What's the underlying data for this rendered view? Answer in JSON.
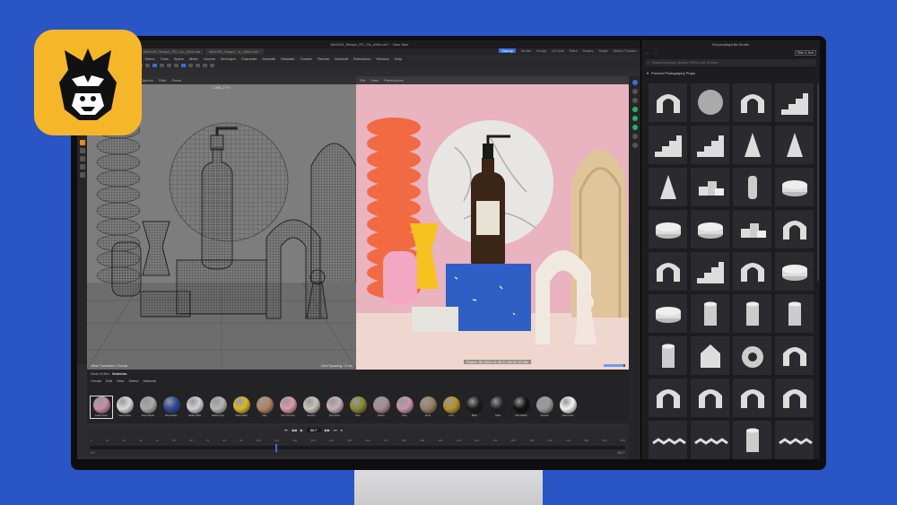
{
  "app": {
    "window_title": "MAXON_Setup1_R3_CA_v004.c4d * - New Take",
    "doc_tabs": [
      "MAXON_Setup1_R3_CA_v004.c4d",
      "MAXON_Setup1_r4_v003.c4d *"
    ],
    "layouts": [
      "Startup",
      "Model",
      "Sculpt",
      "UV Edit",
      "Paint",
      "Nodes",
      "Script",
      "Motion Tracker"
    ],
    "active_layout": "Startup",
    "menus": [
      "File",
      "Edit",
      "Create",
      "Modes",
      "Select",
      "Tools",
      "Spline",
      "Mesh",
      "Volume",
      "MoGraph",
      "Character",
      "Animate",
      "Simulate",
      "Tracker",
      "Render",
      "Redshift",
      "Extensions",
      "Window",
      "Help"
    ]
  },
  "viewport_left": {
    "menus": [
      "View",
      "Cameras",
      "Display",
      "Options",
      "Filter",
      "Panel"
    ],
    "label": "CAM_2 TX",
    "footer_left": "View Transform: Scene",
    "footer_right": "Grid Spacing : 5 cm"
  },
  "viewport_right": {
    "menus": [
      "File",
      "View",
      "Preferences"
    ],
    "render_status": "Frame: 86 2024-11-08 11:58:26 20.00s",
    "progress_label": "Progressive rendering",
    "progress": 0.9
  },
  "materials": {
    "tabs": [
      "Node Editor",
      "Materials"
    ],
    "active_tab": "Materials",
    "menus": [
      "Create",
      "Edit",
      "View",
      "Select",
      "Material"
    ],
    "items": [
      {
        "name": "Scatter Mesh",
        "color": "#c68ea8"
      },
      {
        "name": "Clean White",
        "color": "#d9d9d9"
      },
      {
        "name": "Stone Plastic",
        "color": "#a9a9a9"
      },
      {
        "name": "Blue Plastic",
        "color": "#2d4a9a"
      },
      {
        "name": "Marble White",
        "color": "#d0d0d0"
      },
      {
        "name": "Marble Gray",
        "color": "#b5b5b5"
      },
      {
        "name": "Yellow Paint",
        "color": "#d8b82a"
      },
      {
        "name": "Clay",
        "color": "#b48264"
      },
      {
        "name": "Pink Terrazzo",
        "color": "#d89aa8"
      },
      {
        "name": "Terrazzo",
        "color": "#c9c2b8"
      },
      {
        "name": "Pink Stone",
        "color": "#c8b0b6"
      },
      {
        "name": "Olive",
        "color": "#8a8a32"
      },
      {
        "name": "Mauve",
        "color": "#a88c92"
      },
      {
        "name": "Rose",
        "color": "#c796ac"
      },
      {
        "name": "Wood",
        "color": "#9a7e62"
      },
      {
        "name": "Gold",
        "color": "#b8902c"
      },
      {
        "name": "Black",
        "color": "#1a1a1a"
      },
      {
        "name": "Glass",
        "color": "#222222"
      },
      {
        "name": "Dark Plastic",
        "color": "#111111"
      },
      {
        "name": "Ceramic",
        "color": "#9a9a9a"
      },
      {
        "name": "Glass Clear",
        "color": "#f2f2f2"
      }
    ]
  },
  "timeline": {
    "current_frame": "86 F",
    "start": "0 F",
    "end": "300 F",
    "ruler": [
      "0",
      "10",
      "20",
      "30",
      "40",
      "50",
      "60",
      "70",
      "80",
      "90",
      "100",
      "110",
      "120",
      "130",
      "140",
      "150",
      "160",
      "170",
      "180",
      "190",
      "200",
      "210",
      "220",
      "230",
      "240",
      "250",
      "260",
      "270",
      "280",
      "290",
      "300"
    ]
  },
  "asset_browser": {
    "title": "Greyscalegorilla Studio",
    "filter_label": "Filter & Sort",
    "search_placeholder": "Search Materials, Models, HDRIs, and Textures",
    "section": "Product Photography Props",
    "icons": [
      "arch-prop-icon",
      "disc-prop-icon",
      "arch-tall-prop-icon",
      "stairs-prop-icon",
      "stairs-small-prop-icon",
      "stairs-prop-icon",
      "cone-thin-prop-icon",
      "cone-prop-icon",
      "spike-prop-icon",
      "blocks-prop-icon",
      "pillar-prop-icon",
      "cylinder-step-prop-icon",
      "round-step-prop-icon",
      "round-step-prop-icon",
      "cylinder-cluster-prop-icon",
      "arch-bridge-prop-icon",
      "double-arch-prop-icon",
      "arch-steps-prop-icon",
      "rainbow-arch-prop-icon",
      "scalloped-disc-prop-icon",
      "scalloped-disc-prop-icon",
      "fluted-column-prop-icon",
      "fluted-cylinder-prop-icon",
      "column-prop-icon",
      "column-prop-icon",
      "house-prop-icon",
      "torus-prop-icon",
      "bracket-prop-icon",
      "frame-prop-icon",
      "u-arch-prop-icon",
      "s-curve-prop-icon",
      "arch-block-prop-icon",
      "zigzag-prop-icon",
      "zigzag-prop-icon",
      "coil-prop-icon",
      "pleat-prop-icon"
    ]
  },
  "brand": {
    "badge_color": "#f5b62a",
    "background": "#2a55c4"
  }
}
